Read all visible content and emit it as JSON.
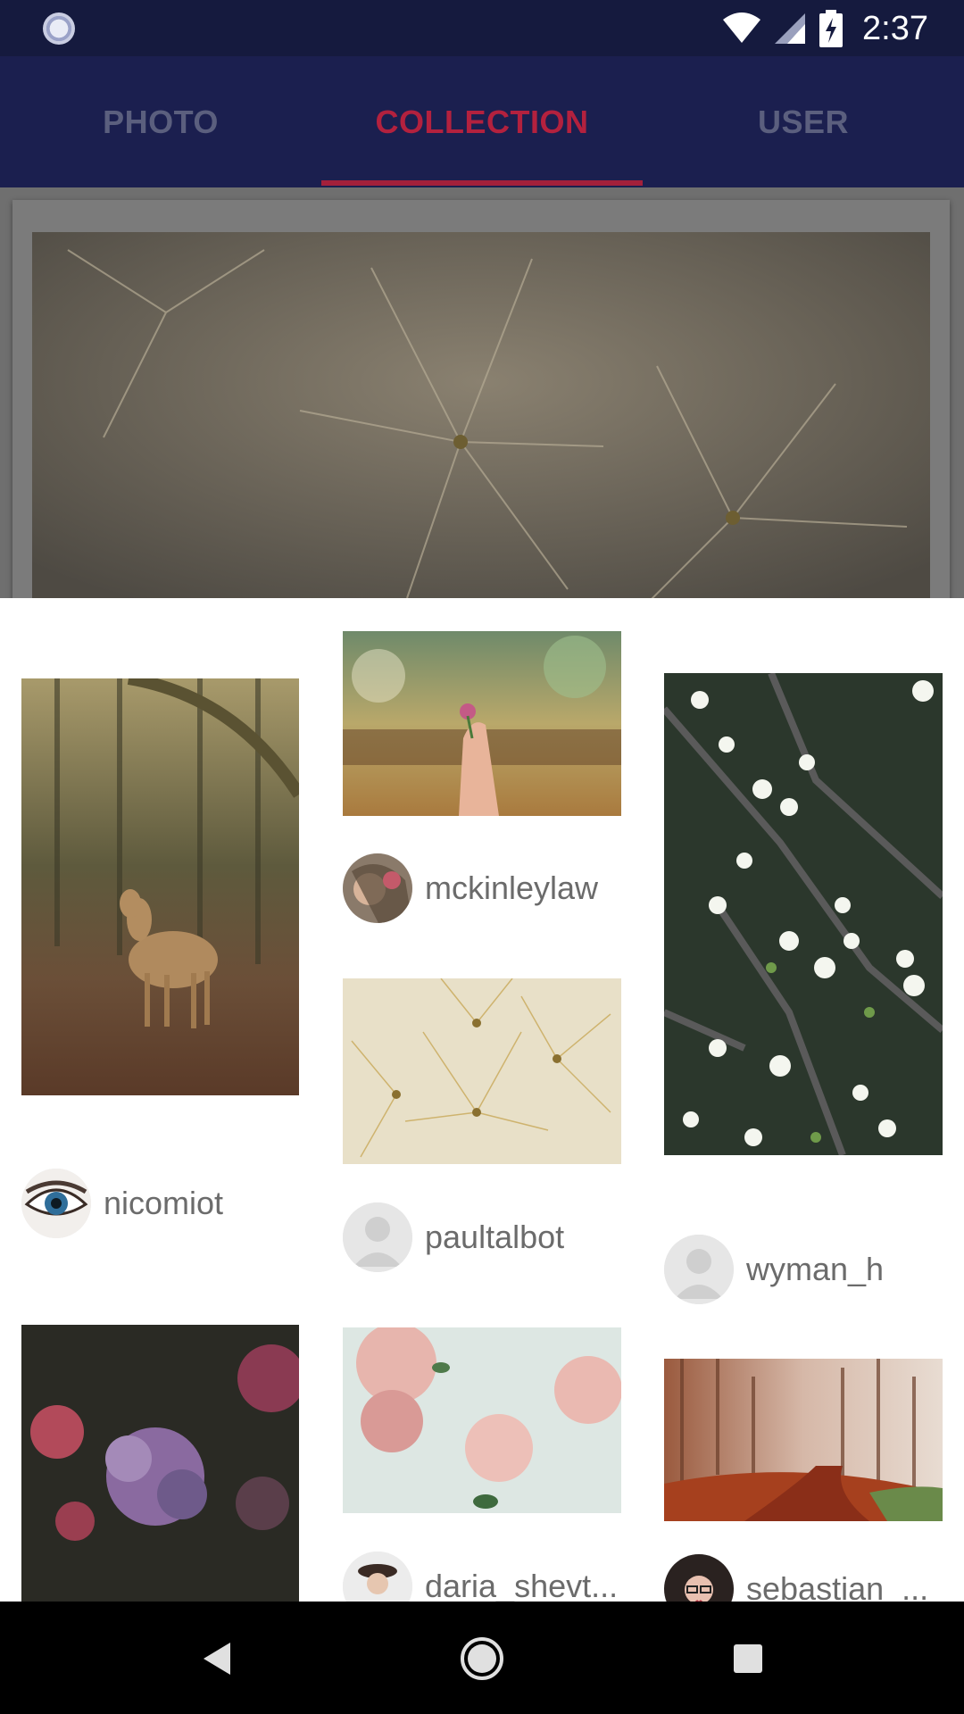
{
  "status_bar": {
    "time": "2:37",
    "icons": [
      "sync-icon",
      "wifi-icon",
      "signal-icon",
      "battery-charging-icon"
    ]
  },
  "tabs": [
    {
      "label": "PHOTO",
      "active": false
    },
    {
      "label": "COLLECTION",
      "active": true
    },
    {
      "label": "USER",
      "active": false
    }
  ],
  "colors": {
    "status_bar": "#151a3e",
    "app_bar": "#1b1f4f",
    "active_tab": "#b3213e",
    "inactive_tab": "#5b5f7e",
    "username_text": "#6b6b6b"
  },
  "sheet": {
    "photos": [
      {
        "id": "deer",
        "user": "nicomiot",
        "avatar": "eye"
      },
      {
        "id": "hand-flower",
        "user": "mckinleylaw",
        "avatar": "photo"
      },
      {
        "id": "dandelion",
        "user": "paultalbot",
        "avatar": "placeholder"
      },
      {
        "id": "blossom",
        "user": "wyman_h",
        "avatar": "placeholder"
      },
      {
        "id": "hydrangea",
        "user": "",
        "avatar": ""
      },
      {
        "id": "roses",
        "user": "daria_shevt...",
        "avatar": "photo"
      },
      {
        "id": "forest-path",
        "user": "sebastian_...",
        "avatar": "photo"
      }
    ]
  },
  "nav_bar": {
    "icons": [
      "back-icon",
      "home-icon",
      "recents-icon"
    ]
  }
}
